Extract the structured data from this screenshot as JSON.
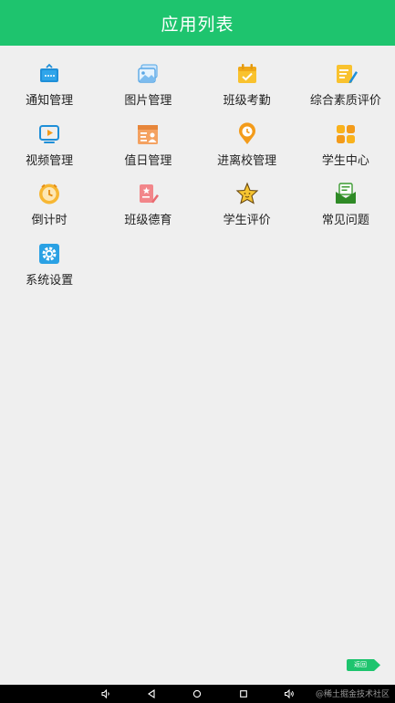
{
  "header": {
    "title": "应用列表",
    "color": "#1ec46e"
  },
  "apps": [
    {
      "label": "通知管理",
      "icon": "notice-icon"
    },
    {
      "label": "图片管理",
      "icon": "picture-icon"
    },
    {
      "label": "班级考勤",
      "icon": "attendance-calendar-icon"
    },
    {
      "label": "综合素质评价",
      "icon": "evaluation-note-icon"
    },
    {
      "label": "视频管理",
      "icon": "video-icon"
    },
    {
      "label": "值日管理",
      "icon": "duty-icon"
    },
    {
      "label": "进离校管理",
      "icon": "location-clock-icon"
    },
    {
      "label": "学生中心",
      "icon": "student-center-icon"
    },
    {
      "label": "倒计时",
      "icon": "alarm-clock-icon"
    },
    {
      "label": "班级德育",
      "icon": "moral-education-icon"
    },
    {
      "label": "学生评价",
      "icon": "star-icon"
    },
    {
      "label": "常见问题",
      "icon": "faq-envelope-icon"
    },
    {
      "label": "系统设置",
      "icon": "settings-gear-icon"
    }
  ],
  "back_button": {
    "label": "返回"
  },
  "navbar": {
    "buttons": [
      "volume-down-icon",
      "back-triangle-icon",
      "home-circle-icon",
      "recents-square-icon",
      "volume-up-icon"
    ],
    "watermark": "@稀土掘金技术社区"
  }
}
